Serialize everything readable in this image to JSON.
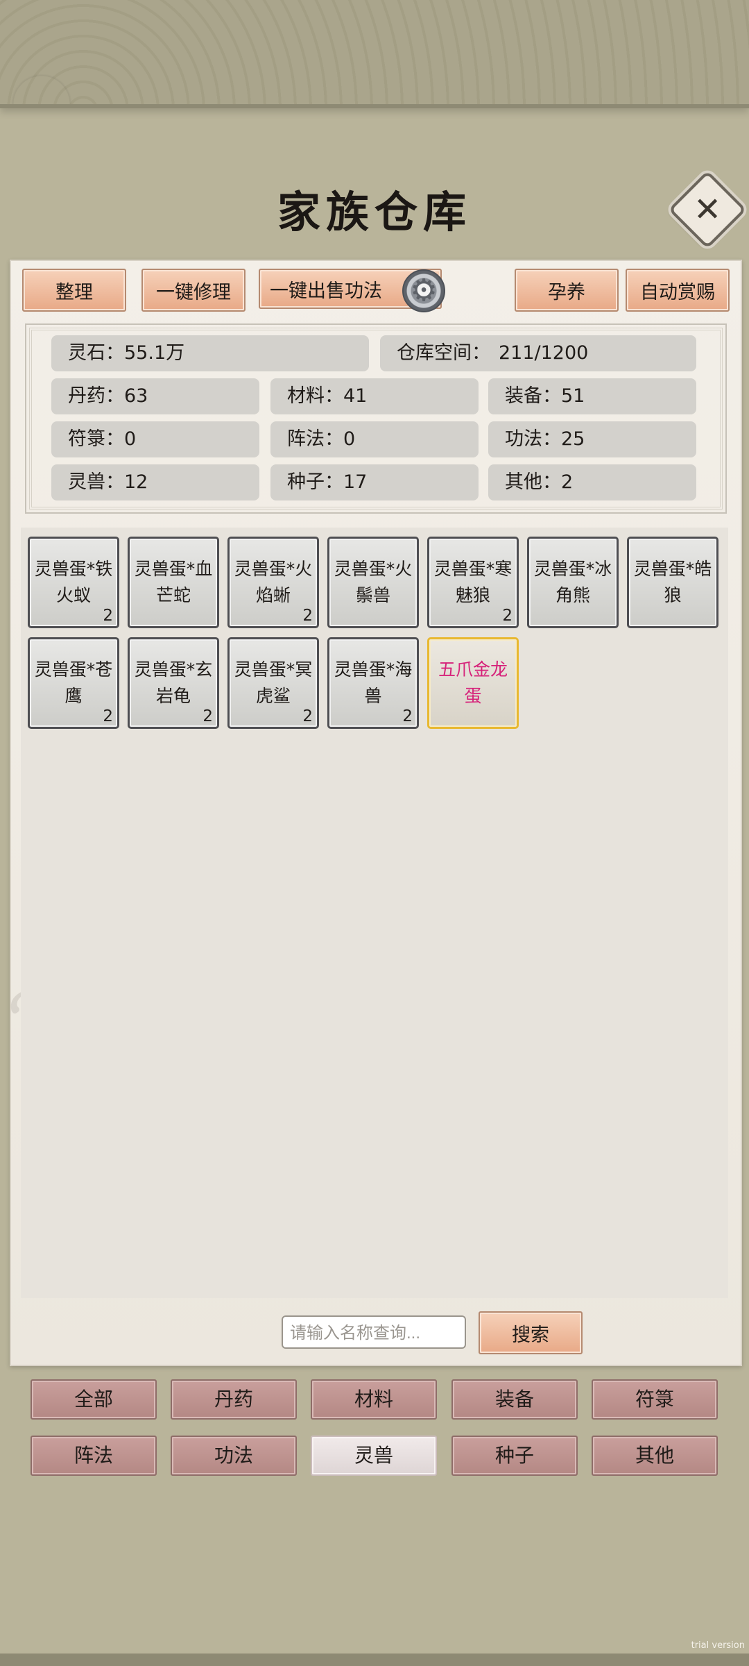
{
  "title": "家族仓库",
  "close_symbol": "✕",
  "toolbar": {
    "sort": "整理",
    "repair_all": "一键修理",
    "sell_skills": "一键出售功法",
    "incubate": "孕养",
    "auto_reward": "自动赏赐"
  },
  "stats": {
    "spirit_stone": {
      "label": "灵石：",
      "value": "55.1万"
    },
    "storage": {
      "label": "仓库空间：",
      "value": "211/1200"
    },
    "pills": {
      "label": "丹药：",
      "value": "63"
    },
    "materials": {
      "label": "材料：",
      "value": "41"
    },
    "equipment": {
      "label": "装备：",
      "value": "51"
    },
    "talismans": {
      "label": "符箓：",
      "value": "0"
    },
    "formations": {
      "label": "阵法：",
      "value": "0"
    },
    "skills": {
      "label": "功法：",
      "value": "25"
    },
    "beasts": {
      "label": "灵兽：",
      "value": "12"
    },
    "seeds": {
      "label": "种子：",
      "value": "17"
    },
    "others": {
      "label": "其他：",
      "value": "2"
    }
  },
  "items": [
    {
      "name": "灵兽蛋*铁火蚁",
      "count": "2"
    },
    {
      "name": "灵兽蛋*血芒蛇",
      "count": ""
    },
    {
      "name": "灵兽蛋*火焰蜥",
      "count": "2"
    },
    {
      "name": "灵兽蛋*火鬃兽",
      "count": ""
    },
    {
      "name": "灵兽蛋*寒魅狼",
      "count": "2"
    },
    {
      "name": "灵兽蛋*冰角熊",
      "count": ""
    },
    {
      "name": "灵兽蛋*皓狼",
      "count": ""
    },
    {
      "name": "灵兽蛋*苍鹰",
      "count": "2"
    },
    {
      "name": "灵兽蛋*玄岩龟",
      "count": "2"
    },
    {
      "name": "灵兽蛋*冥虎鲨",
      "count": "2"
    },
    {
      "name": "灵兽蛋*海兽",
      "count": "2"
    },
    {
      "name": "五爪金龙蛋",
      "count": ""
    }
  ],
  "search": {
    "placeholder": "请输入名称查询...",
    "button": "搜索"
  },
  "tabs": [
    {
      "label": "全部"
    },
    {
      "label": "丹药"
    },
    {
      "label": "材料"
    },
    {
      "label": "装备"
    },
    {
      "label": "符箓"
    },
    {
      "label": "阵法"
    },
    {
      "label": "功法"
    },
    {
      "label": "灵兽",
      "active": true
    },
    {
      "label": "种子"
    },
    {
      "label": "其他"
    }
  ],
  "watermark": "trial version",
  "colors": {
    "background": "#b9b49a",
    "button": "#e8a987",
    "tab": "#b48884",
    "rare_item": "#d6227a",
    "rare_border": "#e8b830"
  }
}
